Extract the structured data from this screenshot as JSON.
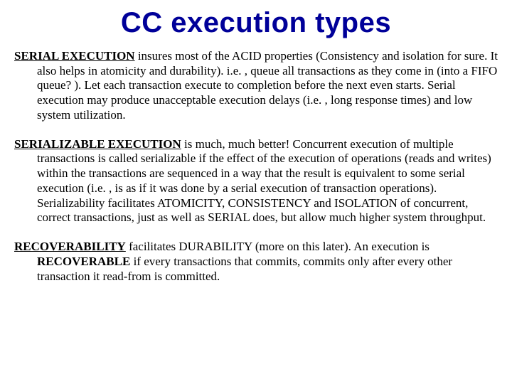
{
  "title": "CC execution types",
  "p1": {
    "lead": "SERIAL EXECUTION",
    "rest": " insures most of the ACID properties (Consistency and isolation for sure. It also helps in atomicity and durability). i.e. , queue all transactions as they come in (into a FIFO queue? ). Let each transaction execute to completion before the next even starts. Serial execution may produce unacceptable execution delays (i.e. , long response times) and low system utilization."
  },
  "p2": {
    "lead": "SERIALIZABLE EXECUTION",
    "rest": " is much, much better!  Concurrent execution of multiple transactions is called serializable if the effect of the execution of operations (reads and writes) within the transactions are sequenced in a way that the result is equivalent to some serial execution (i.e. , is as if it was done by a serial execution of transaction operations).  Serializability facilitates ATOMICITY, CONSISTENCY and ISOLATION of concurrent, correct transactions, just as well as SERIAL does, but allow much higher system throughput."
  },
  "p3": {
    "lead": "RECOVERABILITY",
    "mid": " facilitates DURABILITY (more on this later).  An execution is ",
    "bold2": "RECOVERABLE",
    "rest": " if every transactions that commits, commits only after every other transaction it read-from is committed."
  }
}
